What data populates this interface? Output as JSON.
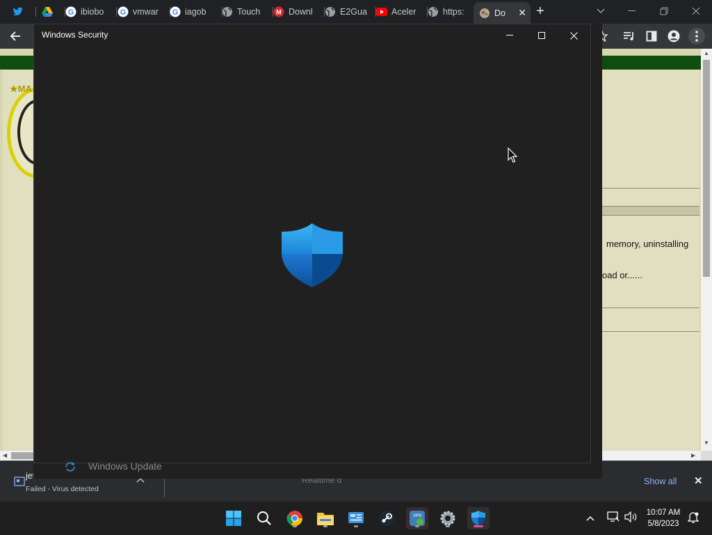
{
  "browser": {
    "tabs": [
      {
        "label": "",
        "icon": "twitter-icon"
      },
      {
        "label": "",
        "icon": "google-drive-icon"
      },
      {
        "label": "ibiobo",
        "icon": "google-icon"
      },
      {
        "label": "vmwar",
        "icon": "google-icon"
      },
      {
        "label": "iagob",
        "icon": "google-icon"
      },
      {
        "label": "Touch",
        "icon": "globe-icon"
      },
      {
        "label": "Downl",
        "icon": "mega-icon"
      },
      {
        "label": "E2Gua",
        "icon": "globe-icon"
      },
      {
        "label": "Aceler",
        "icon": "youtube-icon"
      },
      {
        "label": "https:",
        "icon": "globe-icon"
      },
      {
        "label": "Do",
        "icon": "page-icon",
        "active": true
      }
    ],
    "new_tab": "+"
  },
  "webpage": {
    "logo_text": "★MA",
    "line1": "memory, uninstalling",
    "line2": "oad or......"
  },
  "security_window": {
    "title": "Windows Security",
    "minimize": "–",
    "maximize": "□",
    "close": "✕"
  },
  "downloads": {
    "file_name": "jetc",
    "status": "Failed - Virus detected",
    "show_all": "Show all",
    "close": "✕",
    "behind_label": "Windows Update",
    "behind_fragment": "Realtime d"
  },
  "taskbar": {
    "time": "10:07 AM",
    "date": "5/8/2023",
    "apps": [
      "start-icon",
      "search-icon",
      "chrome-icon",
      "file-explorer-icon",
      "control-panel-icon",
      "steam-icon",
      "vpn-icon",
      "settings-icon",
      "windows-security-icon"
    ]
  },
  "colors": {
    "shield_light": "#2fa8ee",
    "shield_dark": "#0b5cab",
    "window_bg": "#202020",
    "page_bg": "#e0dfc0",
    "link": "#8ab4f8"
  }
}
